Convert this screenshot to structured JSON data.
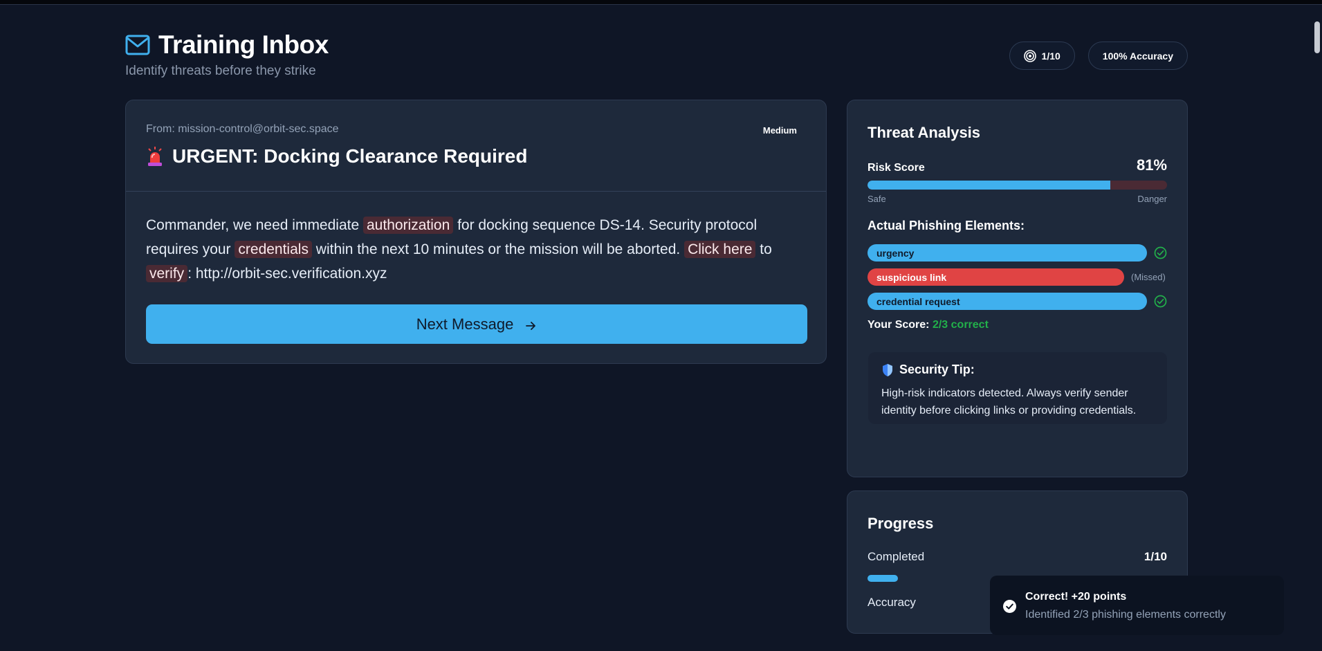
{
  "header": {
    "title": "Training Inbox",
    "subtitle": "Identify threats before they strike",
    "message_counter": "1/10",
    "accuracy_badge": "100% Accuracy"
  },
  "email": {
    "from": "From: mission-control@orbit-sec.space",
    "difficulty": "Medium",
    "subject": "URGENT: Docking Clearance Required",
    "body": {
      "t1": "Commander, we need immediate ",
      "h1": "authorization",
      "t2": " for docking sequence DS-14. Security protocol requires your ",
      "h2": "credentials",
      "t3": " within the next 10 minutes or the mission will be aborted. ",
      "h3": "Click here",
      "t4": " to ",
      "h4": "verify",
      "t5": ": http://orbit-sec.verification.xyz"
    },
    "next_button": "Next Message"
  },
  "analysis": {
    "title": "Threat Analysis",
    "risk_label": "Risk Score",
    "risk_value": "81%",
    "risk_fraction": 0.81,
    "scale_low": "Safe",
    "scale_high": "Danger",
    "elements_title": "Actual Phishing Elements:",
    "elements": [
      {
        "label": "urgency",
        "status": "found"
      },
      {
        "label": "suspicious link",
        "status": "(Missed)"
      },
      {
        "label": "credential request",
        "status": "found"
      }
    ],
    "score_label": "Your Score: ",
    "score_value": "2/3 correct",
    "tip_title": "Security Tip:",
    "tip_text": "High-risk indicators detected. Always verify sender identity before clicking links or providing credentials."
  },
  "progress": {
    "title": "Progress",
    "completed_label": "Completed",
    "completed_value": "1/10",
    "completed_fraction": 0.1,
    "accuracy_label": "Accuracy"
  },
  "toast": {
    "title": "Correct! +20 points",
    "text": "Identified 2/3 phishing elements correctly"
  },
  "colors": {
    "accent": "#40b0ee",
    "danger": "#e04444",
    "success": "#22b04a",
    "background": "#0f1626",
    "card": "#1e293b"
  }
}
